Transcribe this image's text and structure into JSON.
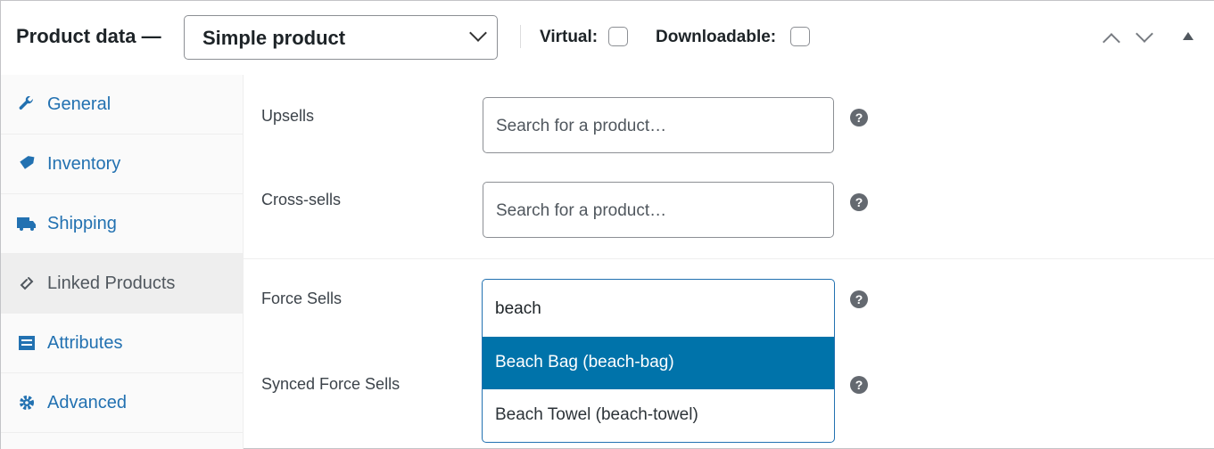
{
  "header": {
    "title": "Product data —",
    "product_type": "Simple product",
    "virtual_label": "Virtual:",
    "virtual_checked": false,
    "downloadable_label": "Downloadable:",
    "downloadable_checked": false
  },
  "sidebar": {
    "items": [
      {
        "label": "General",
        "icon": "wrench-icon"
      },
      {
        "label": "Inventory",
        "icon": "tag-icon"
      },
      {
        "label": "Shipping",
        "icon": "truck-icon"
      },
      {
        "label": "Linked Products",
        "icon": "link-icon",
        "active": true
      },
      {
        "label": "Attributes",
        "icon": "list-icon"
      },
      {
        "label": "Advanced",
        "icon": "gear-icon"
      }
    ]
  },
  "fields": {
    "upsells": {
      "label": "Upsells",
      "placeholder": "Search for a product…"
    },
    "cross_sells": {
      "label": "Cross-sells",
      "placeholder": "Search for a product…"
    },
    "force_sells": {
      "label": "Force Sells",
      "value": "beach",
      "options": [
        "Beach Bag (beach-bag)",
        "Beach Towel (beach-towel)"
      ]
    },
    "synced_force_sells": {
      "label": "Synced Force Sells"
    }
  },
  "help_glyph": "?",
  "colors": {
    "accent": "#2271b1",
    "highlight": "#0073aa"
  }
}
